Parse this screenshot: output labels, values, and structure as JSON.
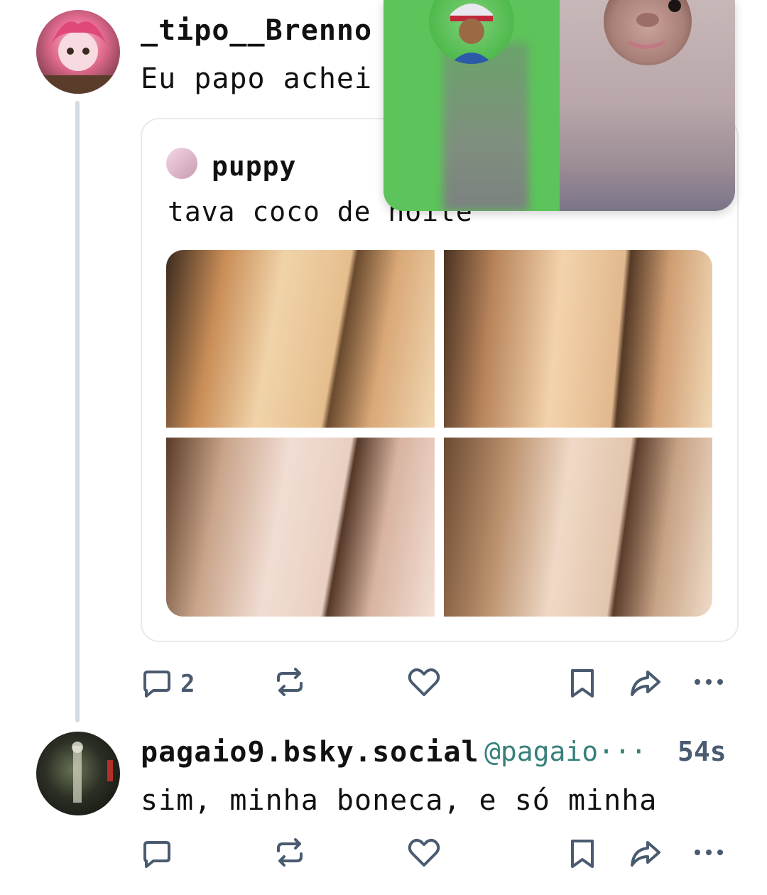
{
  "post1": {
    "author": "_tipo__Brenno",
    "text": "Eu papo achei",
    "quoted": {
      "author": "puppy",
      "text": "tava coco de noite"
    },
    "actions": {
      "reply_count": "2"
    }
  },
  "post2": {
    "author": "pagaio9.bsky.social",
    "handle": "@pagaio···",
    "time": "54s",
    "text": "sim, minha boneca, e só minha"
  },
  "colors": {
    "thread_line": "#d5dbe2",
    "action_icon": "#4a5b70",
    "handle": "#37807a",
    "overlay_left": "#5cc45a"
  },
  "icons": [
    "reply-icon",
    "repost-icon",
    "like-icon",
    "bookmark-icon",
    "share-icon",
    "more-icon"
  ]
}
